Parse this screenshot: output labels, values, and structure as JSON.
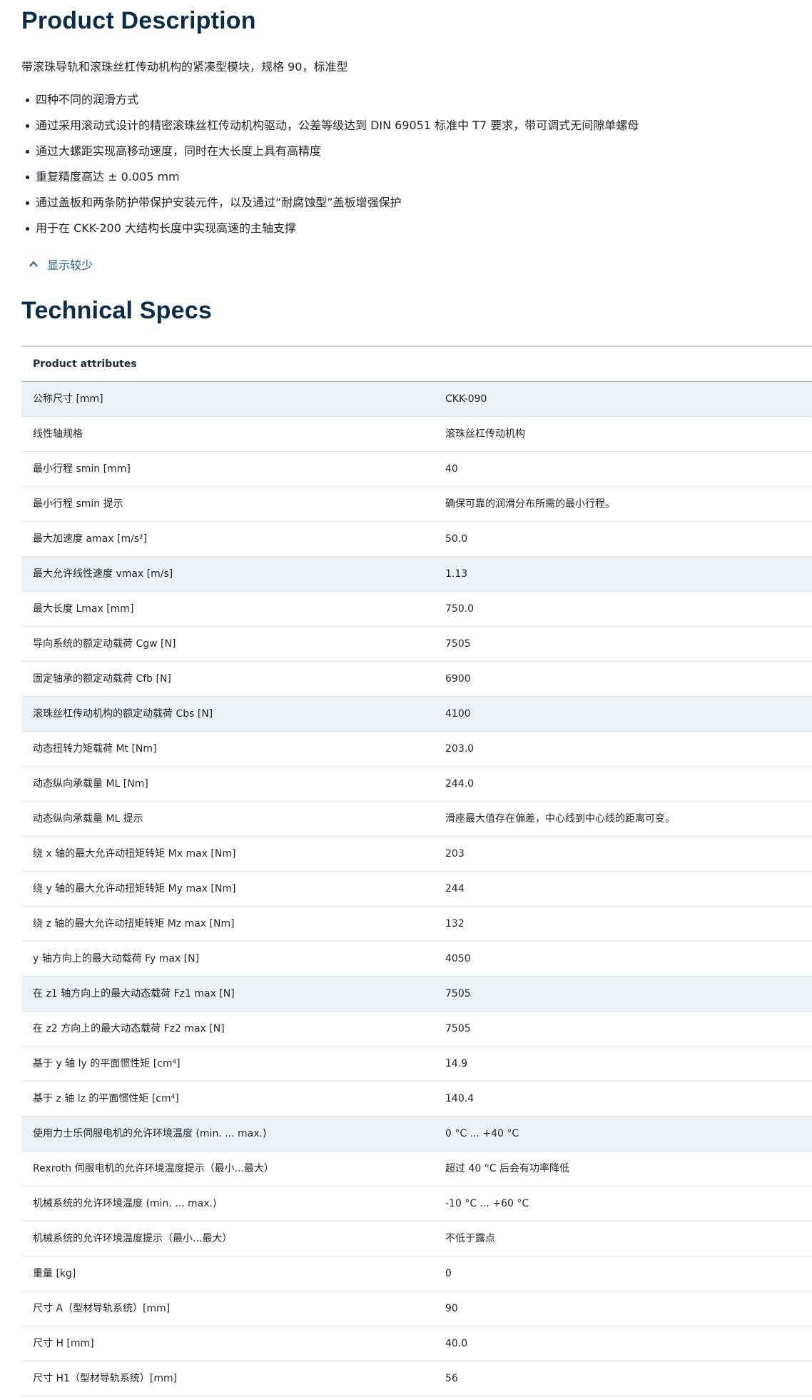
{
  "description": {
    "title": "Product Description",
    "intro": "带滚珠导轨和滚珠丝杠传动机构的紧凑型模块，规格 90，标准型",
    "bullets": [
      "四种不同的润滑方式",
      "通过采用滚动式设计的精密滚珠丝杠传动机构驱动，公差等级达到 DIN 69051 标准中 T7 要求，带可调式无间隙单螺母",
      "通过大螺距实现高移动速度，同时在大长度上具有高精度",
      "重复精度高达 ± 0.005 mm",
      "通过盖板和两条防护带保护安装元件，以及通过“耐腐蚀型”盖板增强保护",
      "用于在 CKK-200 大结构长度中实现高速的主轴支撑"
    ],
    "show_less_label": "显示较少",
    "show_less_icon": "chevron-up-icon",
    "accent_color": "#1c5d86"
  },
  "specs": {
    "title": "Technical Specs",
    "table_header": "Product attributes",
    "rows": [
      {
        "key": "公称尺寸 [mm]",
        "value": "CKK-090",
        "shaded": true
      },
      {
        "key": "线性轴规格",
        "value": "滚珠丝杠传动机构",
        "shaded": false
      },
      {
        "key": "最小行程 smin [mm]",
        "value": "40",
        "shaded": false
      },
      {
        "key": "最小行程 smin 提示",
        "value": "确保可靠的润滑分布所需的最小行程。",
        "shaded": false
      },
      {
        "key": "最大加速度 amax [m/s²]",
        "value": "50.0",
        "shaded": false
      },
      {
        "key": "最大允许线性速度 vmax [m/s]",
        "value": "1.13",
        "shaded": true
      },
      {
        "key": "最大长度 Lmax [mm]",
        "value": "750.0",
        "shaded": false
      },
      {
        "key": "导向系统的额定动载荷 Cgw [N]",
        "value": "7505",
        "shaded": false
      },
      {
        "key": "固定轴承的额定动载荷 Cfb [N]",
        "value": "6900",
        "shaded": false
      },
      {
        "key": "滚珠丝杠传动机构的额定动载荷 Cbs [N]",
        "value": "4100",
        "shaded": true
      },
      {
        "key": "动态扭转力矩载荷 Mt [Nm]",
        "value": "203.0",
        "shaded": false
      },
      {
        "key": "动态纵向承载量 ML [Nm]",
        "value": "244.0",
        "shaded": false
      },
      {
        "key": "动态纵向承载量 ML 提示",
        "value": "滑座最大值存在偏差，中心线到中心线的距离可变。",
        "shaded": false
      },
      {
        "key": "绕 x 轴的最大允许动扭矩转矩 Mx max [Nm]",
        "value": "203",
        "shaded": false
      },
      {
        "key": "绕 y 轴的最大允许动扭矩转矩 My max [Nm]",
        "value": "244",
        "shaded": false
      },
      {
        "key": "绕 z 轴的最大允许动扭矩转矩 Mz max [Nm]",
        "value": "132",
        "shaded": false
      },
      {
        "key": "y 轴方向上的最大动载荷 Fy max [N]",
        "value": "4050",
        "shaded": false
      },
      {
        "key": "在 z1 轴方向上的最大动态载荷 Fz1 max [N]",
        "value": "7505",
        "shaded": true
      },
      {
        "key": "在 z2 方向上的最大动态载荷 Fz2 max [N]",
        "value": "7505",
        "shaded": false
      },
      {
        "key": "基于 y 轴 ly 的平面惯性矩 [cm⁴]",
        "value": "14.9",
        "shaded": false
      },
      {
        "key": "基于 z 轴 lz 的平面惯性矩 [cm⁴]",
        "value": "140.4",
        "shaded": false
      },
      {
        "key": "使用力士乐伺服电机的允许环境温度 (min. ... max.)",
        "value": "0 °C ... +40 °C",
        "shaded": true
      },
      {
        "key": "Rexroth 伺服电机的允许环境温度提示（最小...最大）",
        "value": "超过 40 °C 后会有功率降低",
        "shaded": false
      },
      {
        "key": "机械系统的允许环境温度 (min. ... max.)",
        "value": "-10 °C ... +60 °C",
        "shaded": false
      },
      {
        "key": "机械系统的允许环境温度提示（最小...最大）",
        "value": "不低于露点",
        "shaded": false
      },
      {
        "key": "重量 [kg]",
        "value": "0",
        "shaded": false
      },
      {
        "key": "尺寸 A（型材导轨系统）[mm]",
        "value": "90",
        "shaded": false
      },
      {
        "key": "尺寸 H [mm]",
        "value": "40.0",
        "shaded": false
      },
      {
        "key": "尺寸 H1（型材导轨系统）[mm]",
        "value": "56",
        "shaded": false
      }
    ]
  }
}
